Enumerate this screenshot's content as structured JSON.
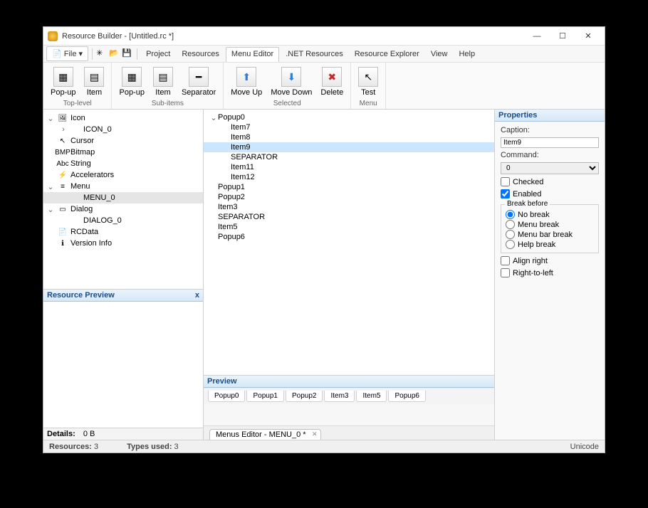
{
  "title": "Resource Builder - [Untitled.rc *]",
  "winbtns": {
    "min": "—",
    "max": "☐",
    "close": "✕"
  },
  "menubar": {
    "file": "File",
    "project": "Project",
    "resources": "Resources",
    "menu_editor": "Menu Editor",
    "net": ".NET Resources",
    "explorer": "Resource Explorer",
    "view": "View",
    "help": "Help"
  },
  "ribbon": {
    "top_level": {
      "label": "Top-level",
      "popup": "Pop-up",
      "item": "Item"
    },
    "sub_items": {
      "label": "Sub-items",
      "popup": "Pop-up",
      "item": "Item",
      "sep": "Separator"
    },
    "selected": {
      "label": "Selected",
      "up": "Move Up",
      "down": "Move Down",
      "del": "Delete"
    },
    "menu": {
      "label": "Menu",
      "test": "Test"
    }
  },
  "tree": [
    {
      "depth": 0,
      "tw": "⌄",
      "icon": "🖼",
      "label": "Icon"
    },
    {
      "depth": 1,
      "tw": "›",
      "icon": "",
      "label": "ICON_0"
    },
    {
      "depth": 0,
      "tw": "",
      "icon": "↖",
      "label": "Cursor"
    },
    {
      "depth": 0,
      "tw": "",
      "icon": "BMP",
      "label": "Bitmap"
    },
    {
      "depth": 0,
      "tw": "",
      "icon": "Abc",
      "label": "String"
    },
    {
      "depth": 0,
      "tw": "",
      "icon": "⚡",
      "label": "Accelerators"
    },
    {
      "depth": 0,
      "tw": "⌄",
      "icon": "≡",
      "label": "Menu"
    },
    {
      "depth": 1,
      "tw": "",
      "icon": "",
      "label": "MENU_0",
      "sel": true
    },
    {
      "depth": 0,
      "tw": "⌄",
      "icon": "▭",
      "label": "Dialog"
    },
    {
      "depth": 1,
      "tw": "",
      "icon": "",
      "label": "DIALOG_0"
    },
    {
      "depth": 0,
      "tw": "",
      "icon": "📄",
      "label": "RCData"
    },
    {
      "depth": 0,
      "tw": "",
      "icon": "ℹ",
      "label": "Version Info"
    }
  ],
  "resource_preview": {
    "title": "Resource Preview",
    "close": "x"
  },
  "details": {
    "label": "Details:",
    "value": "0 B"
  },
  "menu_items": [
    {
      "depth": 0,
      "tw": "⌄",
      "label": "Popup0"
    },
    {
      "depth": 1,
      "tw": "",
      "label": "Item7"
    },
    {
      "depth": 1,
      "tw": "",
      "label": "Item8"
    },
    {
      "depth": 1,
      "tw": "",
      "label": "Item9",
      "sel": true
    },
    {
      "depth": 1,
      "tw": "",
      "label": "SEPARATOR"
    },
    {
      "depth": 1,
      "tw": "",
      "label": "Item11"
    },
    {
      "depth": 1,
      "tw": "",
      "label": "Item12"
    },
    {
      "depth": 0,
      "tw": "",
      "label": "Popup1"
    },
    {
      "depth": 0,
      "tw": "",
      "label": "Popup2"
    },
    {
      "depth": 0,
      "tw": "",
      "label": "Item3"
    },
    {
      "depth": 0,
      "tw": "",
      "label": "SEPARATOR"
    },
    {
      "depth": 0,
      "tw": "",
      "label": "Item5"
    },
    {
      "depth": 0,
      "tw": "",
      "label": "Popup6"
    }
  ],
  "preview": {
    "title": "Preview",
    "tabs": [
      "Popup0",
      "Popup1",
      "Popup2",
      "Item3",
      "Item5",
      "Popup6"
    ]
  },
  "doc_tab": "Menus Editor - MENU_0 *",
  "properties": {
    "title": "Properties",
    "caption_lbl": "Caption:",
    "caption_val": "Item9",
    "command_lbl": "Command:",
    "command_val": "0",
    "checked": "Checked",
    "enabled": "Enabled",
    "break_before": "Break before",
    "radios": [
      "No break",
      "Menu break",
      "Menu bar break",
      "Help break"
    ],
    "align_right": "Align right",
    "rtl": "Right-to-left"
  },
  "status": {
    "resources_lbl": "Resources:",
    "resources_val": "3",
    "types_lbl": "Types used:",
    "types_val": "3",
    "encoding": "Unicode"
  }
}
